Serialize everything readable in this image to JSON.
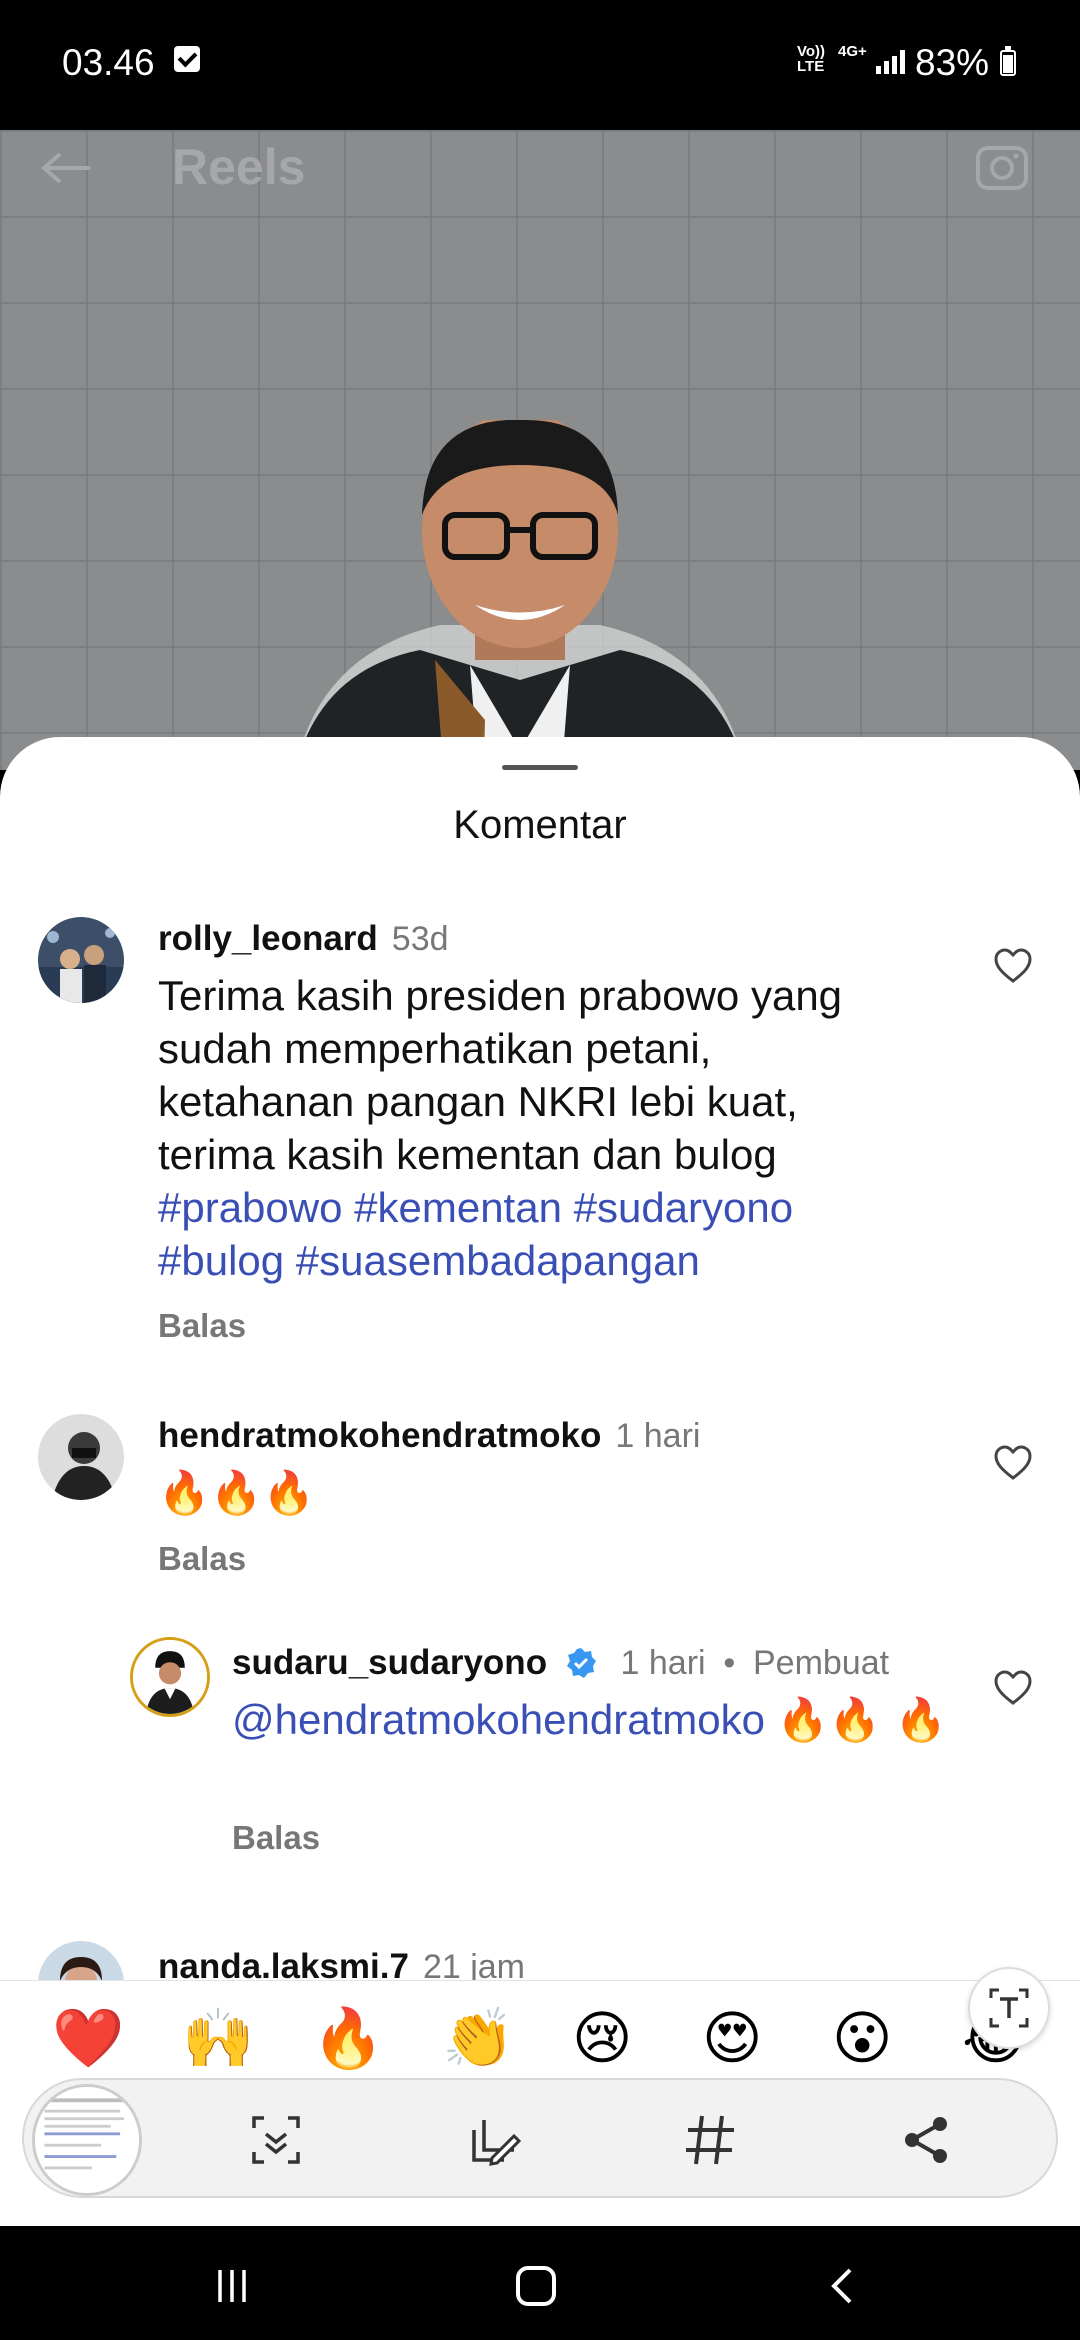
{
  "status_bar": {
    "time": "03.46",
    "network_label": "Vo)) LTE",
    "network_type": "4G+",
    "battery": "83%"
  },
  "reel": {
    "title": "Reels"
  },
  "sheet": {
    "title": "Komentar"
  },
  "comments": [
    {
      "username": "rolly_leonard",
      "time": "53d",
      "text": "Terima kasih presiden prabowo yang sudah memperhatikan petani, ketahanan pangan NKRI lebi kuat, terima kasih kementan dan bulog",
      "tags": "#prabowo #kementan #sudaryono #bulog #suasembadapangan",
      "reply_label": "Balas"
    },
    {
      "username": "hendratmokohendratmoko",
      "time": "1 hari",
      "text": "🔥🔥🔥",
      "reply_label": "Balas"
    },
    {
      "username": "sudaru_sudaryono",
      "time": "1 hari",
      "creator_label": "Pembuat",
      "mention": "@hendratmokohendratmoko",
      "text": "🔥🔥 🔥",
      "reply_label": "Balas"
    },
    {
      "username": "nanda.laksmi.7",
      "time": "21 jam"
    }
  ],
  "emoji_bar": [
    "❤️",
    "🙌",
    "🔥",
    "👏",
    "😢",
    "😍",
    "😮",
    "😂"
  ],
  "toolbar": {
    "icons": [
      "scroll-capture-icon",
      "edit-icon",
      "hashtag-icon",
      "share-icon"
    ]
  },
  "colors": {
    "hashtag": "#3a4fb5",
    "secondary_text": "#777777",
    "verified": "#3897f0"
  }
}
